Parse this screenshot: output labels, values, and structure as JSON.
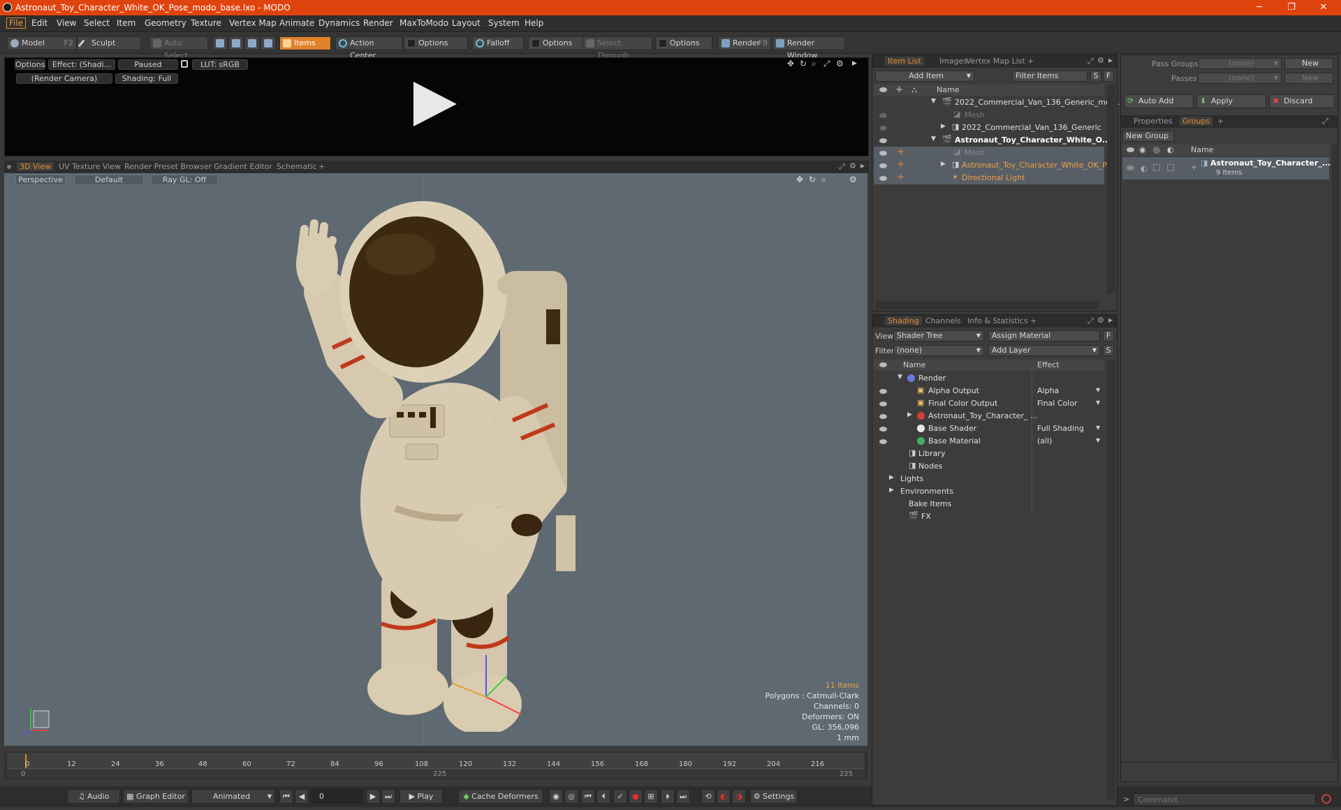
{
  "titlebar": {
    "title": "Astronaut_Toy_Character_White_OK_Pose_modo_base.lxo - MODO",
    "minimize": "─",
    "maximize": "❐",
    "close": "✕"
  },
  "menu": [
    "File",
    "Edit",
    "View",
    "Select",
    "Item",
    "Geometry",
    "Texture",
    "Vertex Map",
    "Animate",
    "Dynamics",
    "Render",
    "MaxToModo",
    "Layout",
    "System",
    "Help"
  ],
  "toolbar": {
    "model": "Model",
    "model_key": "F2",
    "sculpt": "Sculpt",
    "auto_select": "Auto Select",
    "items": "Items",
    "action_center": "Action Center",
    "options1": "Options",
    "falloff": "Falloff",
    "options2": "Options",
    "select_through": "Select Through",
    "options3": "Options",
    "render": "Render",
    "render_key": "F9",
    "render_window": "Render Window"
  },
  "preview": {
    "options": "Options",
    "effect": "Effect: (Shadi...",
    "paused": "Paused",
    "lut": "LUT: sRGB",
    "camera": "(Render Camera)",
    "shading": "Shading: Full"
  },
  "view_tabs": [
    "3D View",
    "UV Texture View",
    "Render Preset Browser",
    "Gradient Editor",
    "Schematic",
    "+"
  ],
  "viewport": {
    "perspective": "Perspective",
    "default": "Default",
    "raygl": "Ray GL: Off",
    "stats": {
      "items": "11 Items",
      "polygons": "Polygons : Catmull-Clark",
      "channels": "Channels: 0",
      "deformers": "Deformers: ON",
      "gl": "GL: 356,096",
      "unit": "1 mm"
    }
  },
  "timeline": {
    "ticks": [
      "0",
      "12",
      "24",
      "36",
      "48",
      "60",
      "72",
      "84",
      "96",
      "108",
      "120",
      "132",
      "144",
      "156",
      "168",
      "180",
      "192",
      "204",
      "216"
    ],
    "start": "0",
    "mid": "225",
    "end": "225"
  },
  "bottombar": {
    "audio": "Audio",
    "graph_editor": "Graph Editor",
    "animated": "Animated",
    "frame": "0",
    "play": "Play",
    "cache": "Cache Deformers",
    "settings": "Settings"
  },
  "item_list": {
    "tabs": [
      "Item List",
      "Images",
      "Vertex Map List",
      "+"
    ],
    "add_item": "Add Item",
    "filter_items": "Filter Items",
    "s": "S",
    "f": "F",
    "name_col": "Name",
    "rows": [
      {
        "label": "2022_Commercial_Van_136_Generic_mod ...",
        "bold": false
      },
      {
        "label": "Mesh",
        "bold": false
      },
      {
        "label": "2022_Commercial_Van_136_Generic",
        "bold": false
      },
      {
        "label": "Astronaut_Toy_Character_White_O...",
        "bold": true
      },
      {
        "label": "Mesh",
        "bold": false
      },
      {
        "label": "Astronaut_Toy_Character_White_OK_P...",
        "bold": false
      },
      {
        "label": "Directional Light",
        "bold": false
      }
    ]
  },
  "groups_panel": {
    "pass_groups": "Pass Groups",
    "passes": "Passes",
    "none1": "(none)",
    "none2": "(none)",
    "new1": "New",
    "new2": "New",
    "auto_add": "Auto Add",
    "apply": "Apply",
    "discard": "Discard",
    "tabs": [
      "Properties",
      "Groups",
      "+"
    ],
    "new_group": "New Group",
    "name_col": "Name",
    "group_name": "Astronaut_Toy_Character_...",
    "group_count": "9 Items"
  },
  "shading": {
    "tabs": [
      "Shading",
      "Channels",
      "Info & Statistics",
      "+"
    ],
    "view_label": "View",
    "view_value": "Shader Tree",
    "assign": "Assign Material",
    "f": "F",
    "filter_label": "Filter",
    "filter_value": "(none)",
    "add_layer": "Add Layer",
    "s": "S",
    "name_col": "Name",
    "effect_col": "Effect",
    "rows": [
      {
        "label": "Render",
        "effect": ""
      },
      {
        "label": "Alpha Output",
        "effect": "Alpha"
      },
      {
        "label": "Final Color Output",
        "effect": "Final Color"
      },
      {
        "label": "Astronaut_Toy_Character_ ...",
        "effect": ""
      },
      {
        "label": "Base Shader",
        "effect": "Full Shading"
      },
      {
        "label": "Base Material",
        "effect": "(all)"
      },
      {
        "label": "Library",
        "effect": ""
      },
      {
        "label": "Nodes",
        "effect": ""
      },
      {
        "label": "Lights",
        "effect": ""
      },
      {
        "label": "Environments",
        "effect": ""
      },
      {
        "label": "Bake Items",
        "effect": ""
      },
      {
        "label": "FX",
        "effect": ""
      }
    ]
  },
  "command": {
    "placeholder": "Command",
    "prompt": ">"
  },
  "colors": {
    "accent": "#e0822a",
    "titlebar": "#e0440e",
    "viewport_bg": "#5e6972",
    "suit": "#d8cbb2",
    "stripe": "#c0391b"
  }
}
